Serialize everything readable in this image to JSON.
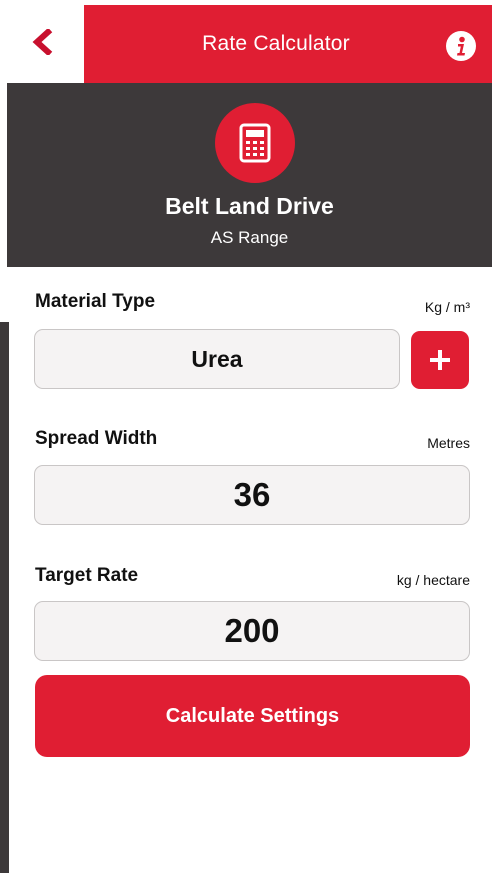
{
  "header": {
    "title": "Rate Calculator",
    "back_icon": "chevron-left-icon",
    "info_icon": "info-icon"
  },
  "hero": {
    "icon": "calculator-icon",
    "title": "Belt Land Drive",
    "subtitle": "AS Range"
  },
  "form": {
    "material": {
      "label": "Material Type",
      "unit": "Kg / m³",
      "value": "Urea",
      "add_icon": "plus-icon"
    },
    "spread": {
      "label": "Spread Width",
      "unit": "Metres",
      "value": "36"
    },
    "rate": {
      "label": "Target Rate",
      "unit": "kg / hectare",
      "value": "200"
    }
  },
  "actions": {
    "calculate_label": "Calculate Settings"
  },
  "colors": {
    "accent": "#e01e33",
    "header_dark": "#3d393a"
  }
}
